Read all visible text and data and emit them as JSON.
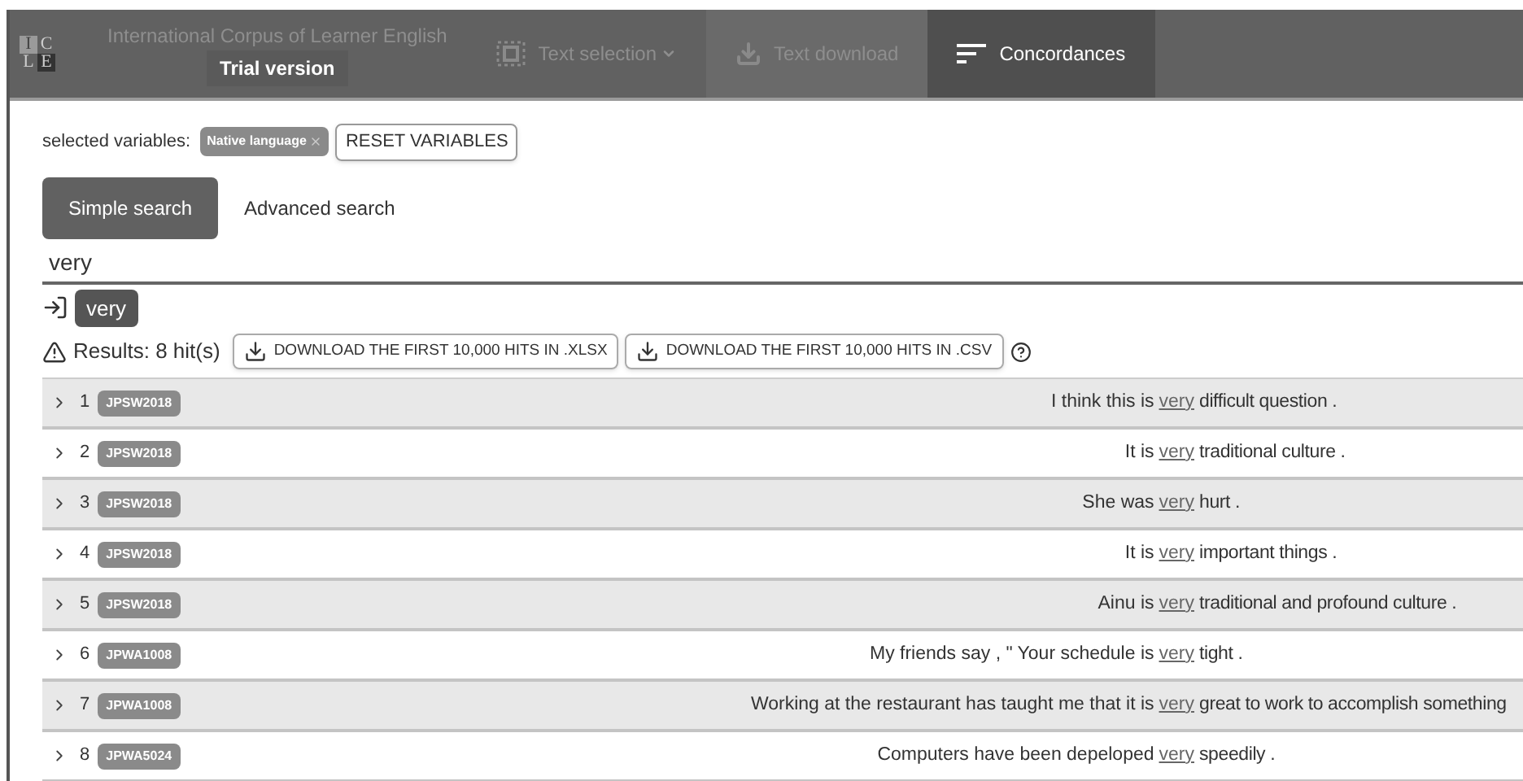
{
  "logo": {
    "letters": [
      "I",
      "C",
      "L",
      "E"
    ]
  },
  "nav": [
    {
      "kind": "title",
      "label": "International Corpus of Learner English",
      "sub": "Trial version",
      "selected": false
    },
    {
      "kind": "selection",
      "label": "Text selection",
      "selected": false
    },
    {
      "kind": "download",
      "label": "Text download",
      "selected": false
    },
    {
      "kind": "concordances",
      "label": "Concordances",
      "selected": true
    }
  ],
  "variables": {
    "label": "selected variables:",
    "chips": [
      "Native language"
    ],
    "reset": "RESET VARIABLES"
  },
  "search_tabs": [
    {
      "label": "Simple search",
      "selected": true
    },
    {
      "label": "Advanced search",
      "selected": false
    }
  ],
  "search": {
    "value": "very"
  },
  "query_chip": "very",
  "results": {
    "label": "Results: 8 hit(s)",
    "buttons": [
      "DOWNLOAD THE FIRST 10,000 HITS IN .XLSX",
      "DOWNLOAD THE FIRST 10,000 HITS IN .CSV"
    ]
  },
  "rows": [
    {
      "num": "1",
      "code": "JPSW2018",
      "left": "I think this is",
      "key": "very",
      "right": "difficult question ."
    },
    {
      "num": "2",
      "code": "JPSW2018",
      "left": "It is",
      "key": "very",
      "right": "traditional culture ."
    },
    {
      "num": "3",
      "code": "JPSW2018",
      "left": "She was",
      "key": "very",
      "right": "hurt ."
    },
    {
      "num": "4",
      "code": "JPSW2018",
      "left": "It is",
      "key": "very",
      "right": "important things ."
    },
    {
      "num": "5",
      "code": "JPSW2018",
      "left": "Ainu is",
      "key": "very",
      "right": "traditional and profound culture ."
    },
    {
      "num": "6",
      "code": "JPWA1008",
      "left": "My friends say , \" Your schedule is",
      "key": "very",
      "right": "tight ."
    },
    {
      "num": "7",
      "code": "JPWA1008",
      "left": "Working at the restaurant has taught me that it is",
      "key": "very",
      "right": "great to work to accomplish something"
    },
    {
      "num": "8",
      "code": "JPWA5024",
      "left": "Computers have been depeloped",
      "key": "very",
      "right": "speedily ."
    }
  ]
}
